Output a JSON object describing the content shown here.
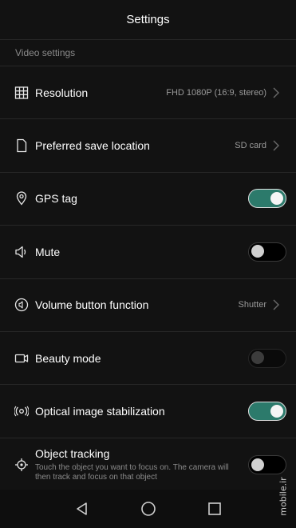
{
  "header": {
    "title": "Settings"
  },
  "section": {
    "label": "Video settings"
  },
  "rows": [
    {
      "label": "Resolution",
      "value": "FHD 1080P (16:9, stereo)",
      "icon": "grid-icon",
      "control": "chevron"
    },
    {
      "label": "Preferred save location",
      "value": "SD card",
      "icon": "file-icon",
      "control": "chevron"
    },
    {
      "label": "GPS tag",
      "icon": "location-pin-icon",
      "control": "toggle",
      "state": "on"
    },
    {
      "label": "Mute",
      "icon": "speaker-icon",
      "control": "toggle",
      "state": "off"
    },
    {
      "label": "Volume button function",
      "value": "Shutter",
      "icon": "volume-circle-icon",
      "control": "chevron"
    },
    {
      "label": "Beauty mode",
      "icon": "video-camera-icon",
      "control": "toggle",
      "state": "disabled"
    },
    {
      "label": "Optical image stabilization",
      "icon": "stabilization-icon",
      "control": "toggle",
      "state": "on"
    },
    {
      "label": "Object tracking",
      "sublabel": "Touch the object you want to focus on. The camera will then track and focus on that object",
      "icon": "crosshair-icon",
      "control": "toggle",
      "state": "off"
    }
  ],
  "navbar": {
    "icons": [
      "back-triangle-icon",
      "home-circle-icon",
      "recents-square-icon"
    ]
  },
  "watermark": {
    "text": "mobile.ir"
  },
  "colors": {
    "toggle_on": "#2c7a6b",
    "background": "#121212",
    "divider": "#262626"
  }
}
